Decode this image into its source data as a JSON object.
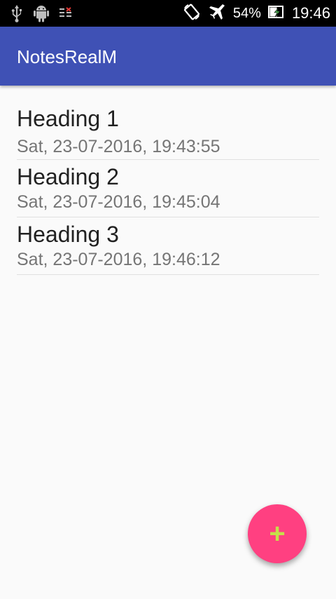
{
  "status_bar": {
    "battery": "54%",
    "time": "19:46",
    "icons": [
      "usb-icon",
      "android-icon",
      "notification-icon",
      "screen-rotate-icon",
      "airplane-mode-icon",
      "battery-charging-icon"
    ]
  },
  "app_bar": {
    "title": "NotesRealM"
  },
  "notes": [
    {
      "title": "Heading 1",
      "date": "Sat, 23-07-2016, 19:43:55"
    },
    {
      "title": "Heading 2",
      "date": "Sat, 23-07-2016, 19:45:04"
    },
    {
      "title": "Heading 3",
      "date": "Sat, 23-07-2016, 19:46:12"
    }
  ],
  "fab": {
    "label": "+"
  },
  "colors": {
    "primary": "#3f51b5",
    "accent": "#ff4081",
    "fab_icon": "#c6e04a"
  }
}
